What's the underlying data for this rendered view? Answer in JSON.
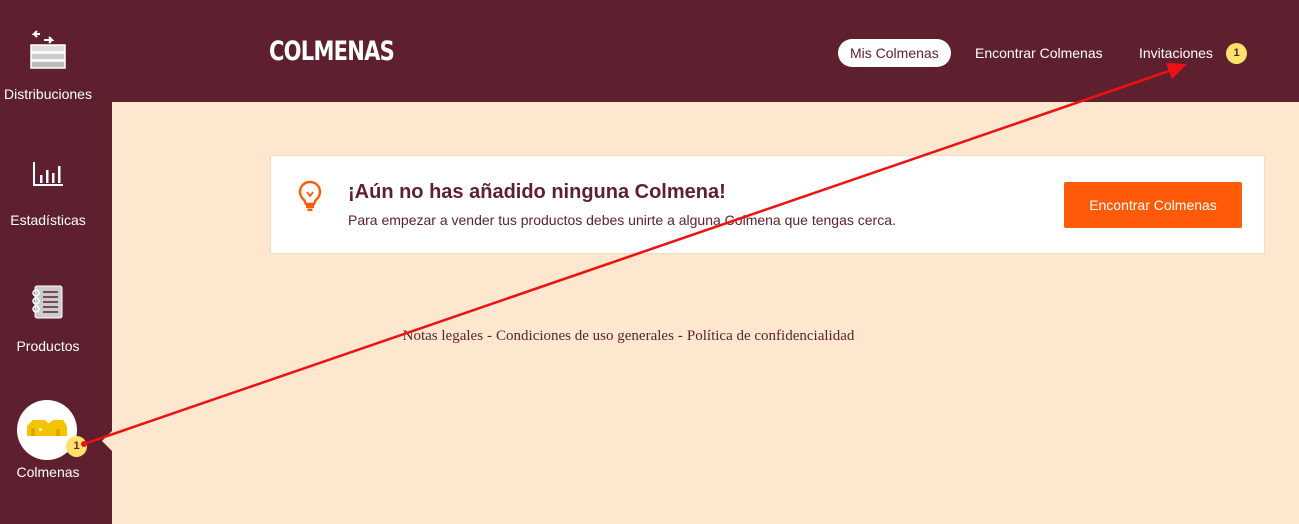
{
  "sidebar": {
    "items": [
      {
        "label": "Distribuciones",
        "icon": "distribution-icon"
      },
      {
        "label": "Estadísticas",
        "icon": "bar-chart-icon"
      },
      {
        "label": "Productos",
        "icon": "notebook-icon"
      },
      {
        "label": "Colmenas",
        "icon": "hive-icon",
        "active": true,
        "badge": "1"
      }
    ]
  },
  "header": {
    "brand": "COLMENAS",
    "tabs": [
      {
        "label": "Mis Colmenas",
        "active": true
      },
      {
        "label": "Encontrar Colmenas"
      },
      {
        "label": "Invitaciones",
        "badge": "1"
      }
    ]
  },
  "notice": {
    "title": "¡Aún no has añadido ninguna Colmena!",
    "text": "Para empezar a vender tus productos debes unirte a alguna Colmena que tengas cerca.",
    "button": "Encontrar Colmenas",
    "icon": "lightbulb-icon"
  },
  "footer": {
    "links": [
      "Notas legales",
      "Condiciones de uso generales",
      "Política de confidencialidad"
    ],
    "separator": "-"
  },
  "colors": {
    "primary": "#5e1f2e",
    "background": "#fde8cf",
    "accent": "#ff5a0a",
    "badge": "#ffe26b",
    "annotation": "#ee1111"
  }
}
